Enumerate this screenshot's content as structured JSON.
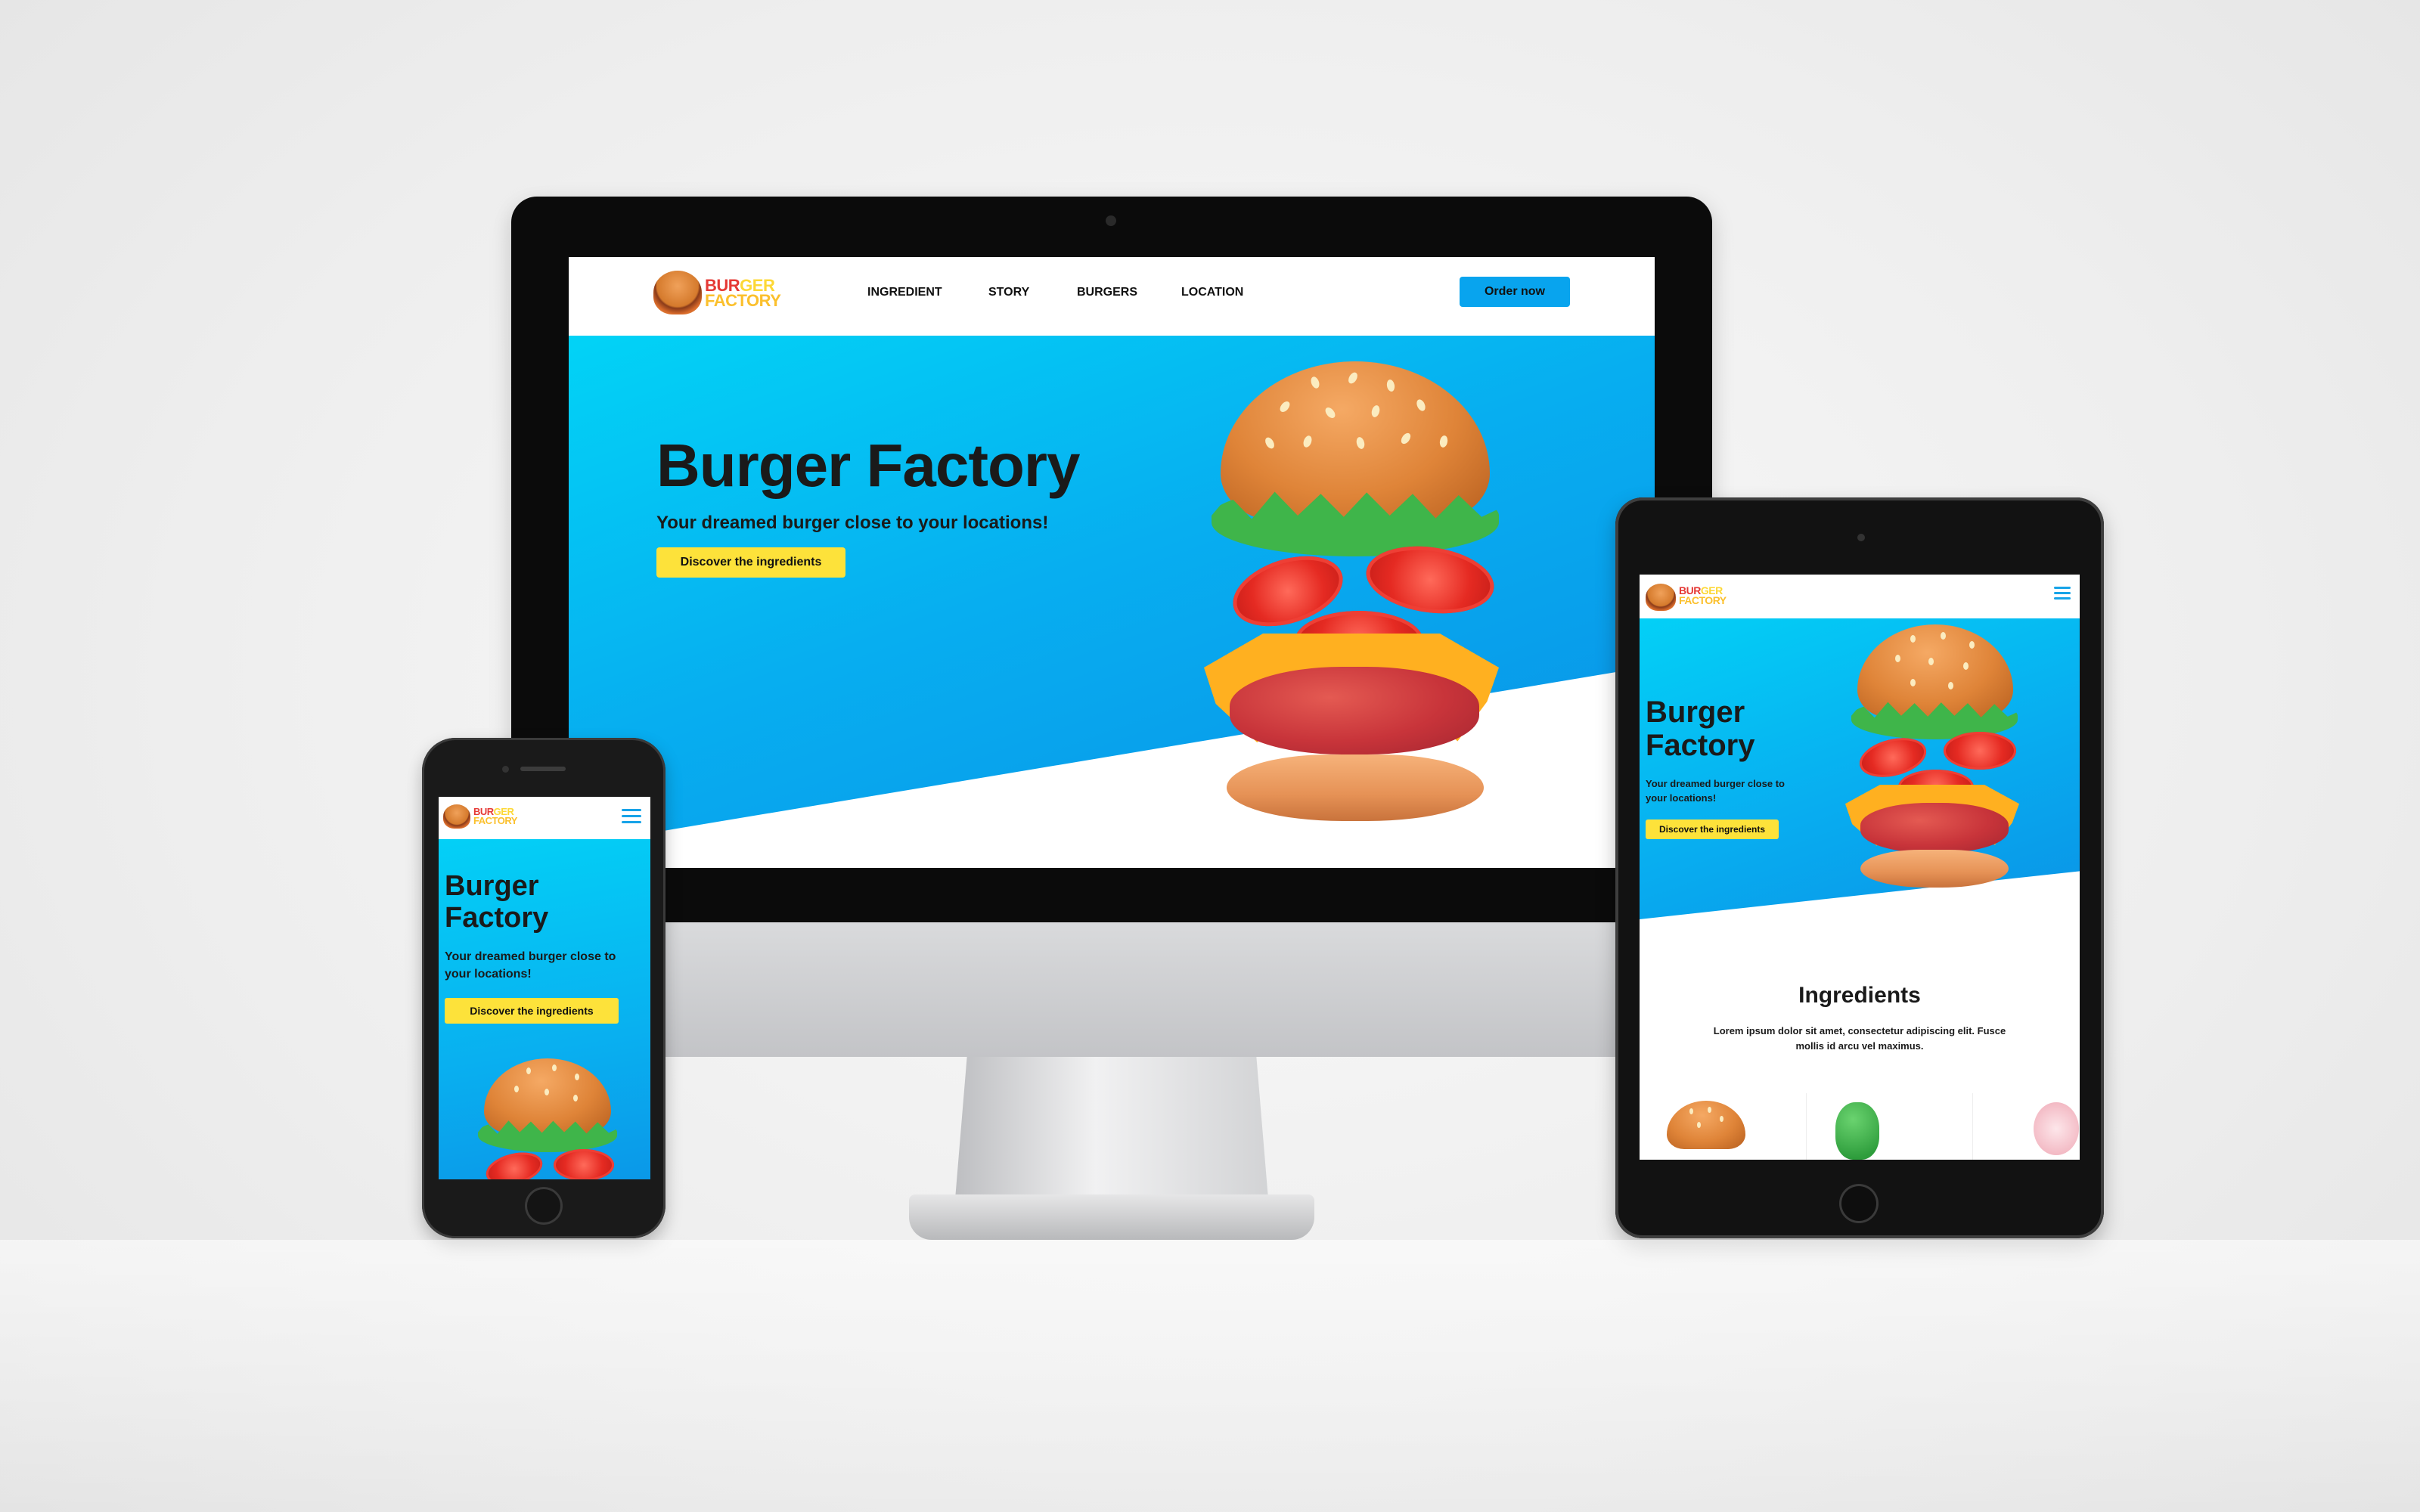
{
  "brand": {
    "logo_line1_a": "BUR",
    "logo_line1_b": "GER",
    "logo_line2": "FACTORY",
    "colors": {
      "accent_blue": "#08a4ee",
      "cta_yellow": "#fde23a",
      "logo_red": "#e53935",
      "logo_yellow": "#fbc02d"
    }
  },
  "desktop": {
    "nav": [
      {
        "label": "INGREDIENT"
      },
      {
        "label": "STORY"
      },
      {
        "label": "BURGERS"
      },
      {
        "label": "LOCATION"
      }
    ],
    "order_button": "Order now",
    "hero": {
      "title": "Burger Factory",
      "subtitle": "Your dreamed burger close to your locations!",
      "cta": "Discover the ingredients"
    }
  },
  "phone": {
    "menu_icon": "hamburger-menu-icon",
    "hero": {
      "title_line1": "Burger",
      "title_line2": "Factory",
      "subtitle_line1": "Your dreamed burger close to",
      "subtitle_line2": "your locations!",
      "cta": "Discover the ingredients"
    }
  },
  "tablet": {
    "menu_icon": "hamburger-menu-icon",
    "hero": {
      "title_line1": "Burger",
      "title_line2": "Factory",
      "subtitle_line1": "Your dreamed burger close to",
      "subtitle_line2": "your locations!",
      "cta": "Discover the ingredients"
    },
    "ingredients": {
      "title": "Ingredients",
      "text_line1": "Lorem ipsum dolor sit amet, consectetur adipiscing elit. Fusce",
      "text_line2": "mollis id arcu vel maximus."
    }
  }
}
